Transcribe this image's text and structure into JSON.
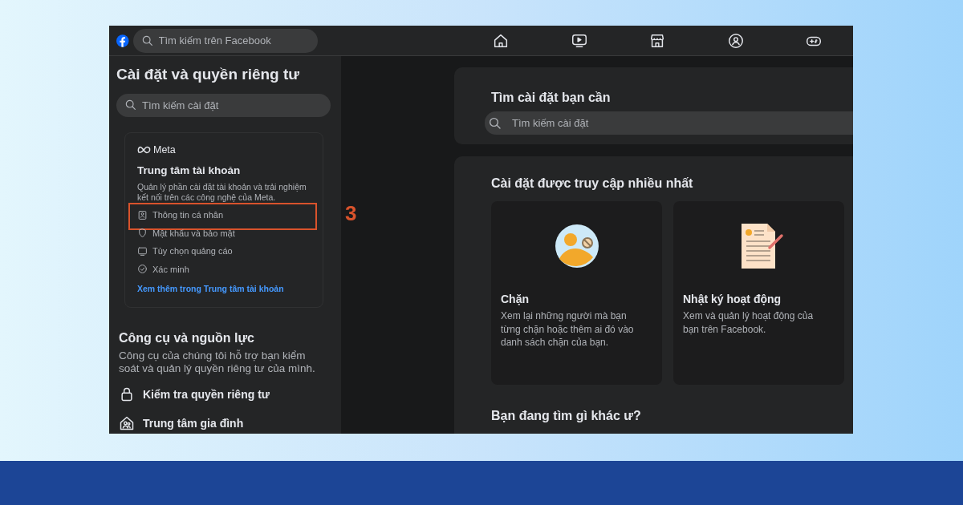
{
  "top_bar": {
    "search": {
      "placeholder": "Tìm kiếm trên Facebook"
    }
  },
  "sidebar": {
    "title": "Cài đặt và quyền riêng tư",
    "search": {
      "placeholder": "Tìm kiếm cài đặt"
    },
    "accounts_center": {
      "brand": "Meta",
      "title": "Trung tâm tài khoản",
      "description": "Quản lý phần cài đặt tài khoản và trải nghiệm kết nối trên các công nghệ của Meta.",
      "items": [
        {
          "kind": "personal",
          "label": "Thông tin cá nhân",
          "highlighted": true,
          "step": "3"
        },
        {
          "kind": "security",
          "label": "Mật khẩu và bảo mật",
          "highlighted": false
        },
        {
          "kind": "ads",
          "label": "Tùy chọn quảng cáo",
          "highlighted": false
        },
        {
          "kind": "verify",
          "label": "Xác minh",
          "highlighted": false
        }
      ],
      "link": "Xem thêm trong Trung tâm tài khoản"
    },
    "tools": {
      "title": "Công cụ và nguồn lực",
      "description": "Công cụ của chúng tôi hỗ trợ bạn kiểm soát và quản lý quyền riêng tư của mình.",
      "items": [
        {
          "kind": "lock",
          "label": "Kiểm tra quyền riêng tư"
        },
        {
          "kind": "family",
          "label": "Trung tâm gia đình"
        }
      ]
    }
  },
  "main": {
    "search_card": {
      "title": "Tìm cài đặt bạn cần",
      "search": {
        "placeholder": "Tìm kiếm cài đặt"
      }
    },
    "most_visited": {
      "title": "Cài đặt được truy cập nhiều nhất",
      "cards": [
        {
          "kind": "block",
          "title": "Chặn",
          "description": "Xem lại những người mà bạn từng chặn hoặc thêm ai đó vào danh sách chặn của bạn."
        },
        {
          "kind": "activity",
          "title": "Nhật ký hoạt động",
          "description": "Xem và quản lý hoạt động của bạn trên Facebook."
        }
      ]
    },
    "more": {
      "title": "Bạn đang tìm gì khác ư?"
    }
  }
}
